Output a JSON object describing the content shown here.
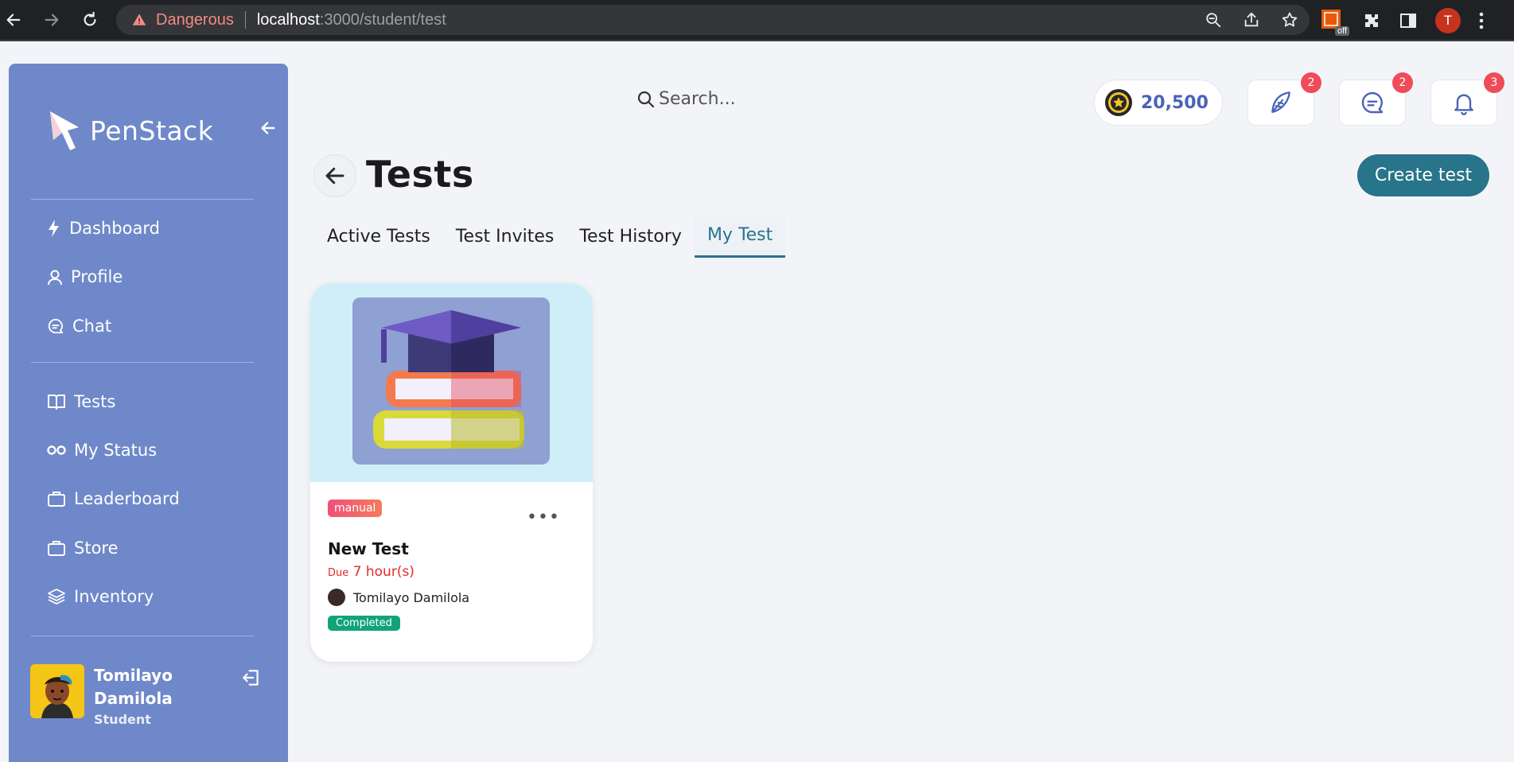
{
  "browser": {
    "security_label": "Dangerous",
    "url_host": "localhost",
    "url_path": ":3000/student/test",
    "extension_badge": "off",
    "profile_initial": "T"
  },
  "sidebar": {
    "brand": "PenStack",
    "items": [
      {
        "label": "Dashboard",
        "icon": "lightning-icon"
      },
      {
        "label": "Profile",
        "icon": "user-icon"
      },
      {
        "label": "Chat",
        "icon": "chat-icon"
      },
      {
        "label": "Tests",
        "icon": "book-icon"
      },
      {
        "label": "My Status",
        "icon": "infinity-icon"
      },
      {
        "label": "Leaderboard",
        "icon": "briefcase-icon"
      },
      {
        "label": "Store",
        "icon": "briefcase-icon"
      },
      {
        "label": "Inventory",
        "icon": "layers-icon"
      }
    ],
    "user": {
      "name": "Tomilayo Damilola",
      "role": "Student"
    }
  },
  "topbar": {
    "search_placeholder": "Search...",
    "coins": "20,500",
    "badges": {
      "feather": "2",
      "messages": "2",
      "notifications": "3"
    }
  },
  "page": {
    "title": "Tests",
    "create_button": "Create test",
    "tabs": [
      "Active Tests",
      "Test Invites",
      "Test History",
      "My Test"
    ],
    "active_tab": "My Test"
  },
  "cards": [
    {
      "tag": "manual",
      "title": "New Test",
      "due_prefix": "Due",
      "due_value": "7 hour(s)",
      "owner": "Tomilayo Damilola",
      "status": "Completed"
    }
  ],
  "colors": {
    "sidebar": "#6f88c9",
    "accent": "#28748a",
    "badge": "#f04b58",
    "completed": "#13a37a",
    "due": "#e22a2a"
  }
}
